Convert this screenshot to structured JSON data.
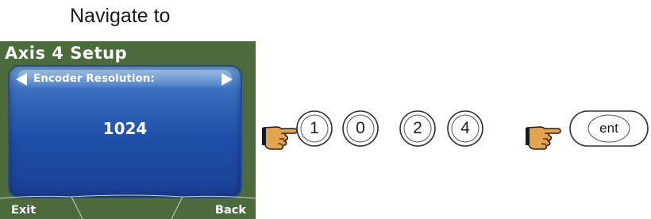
{
  "caption": "Navigate to",
  "lcd": {
    "title": "Axis 4 Setup",
    "parameter_label": "Encoder Resolution:",
    "parameter_value": "1024",
    "softkeys": {
      "left": "Exit",
      "right": "Back"
    },
    "colors": {
      "bezel": "#4b6b3c",
      "panel": "#1f4fa8",
      "text": "#ffffff"
    }
  },
  "keypad_sequence": {
    "pointer_icon": "pointing-hand-icon",
    "digit_keys": [
      "1",
      "0",
      "2",
      "4"
    ],
    "enter_key": "ent"
  }
}
